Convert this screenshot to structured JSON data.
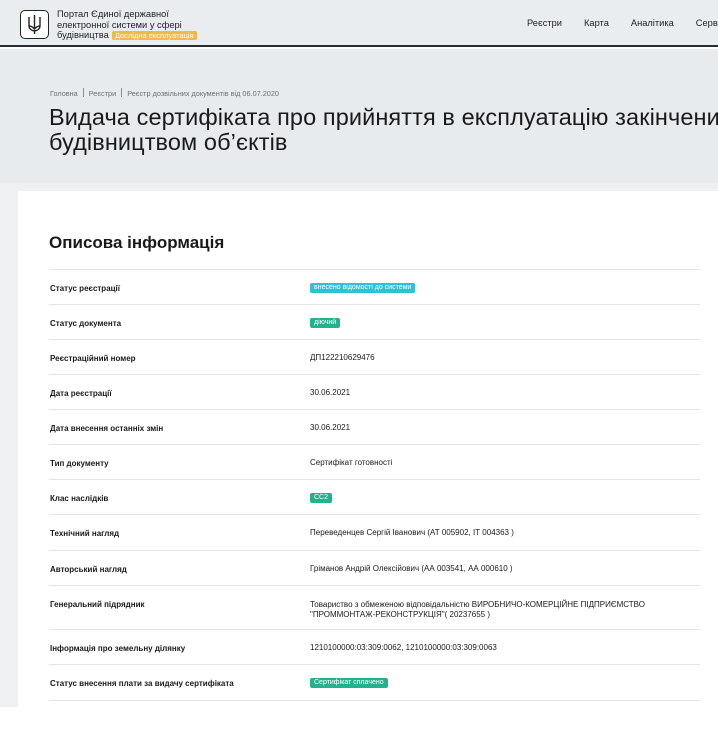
{
  "header": {
    "brand_line1": "Портал Єдиної державної",
    "brand_line2": "електронної системи у сфері",
    "brand_line3": "будівництва",
    "beta_badge": "Дослідна експлуатація",
    "nav": [
      "Реєстри",
      "Карта",
      "Аналітика",
      "Сервіс"
    ]
  },
  "breadcrumb": [
    "Головна",
    "Реєстри",
    "Реєстр дозвільних документів від 06.07.2020"
  ],
  "page_title": "Видача сертифіката про прийняття в експлуатацію закінчених будівництвом об’єктів",
  "section_title": "Описова інформація",
  "rows": [
    {
      "label": "Статус реєстрації",
      "value": "внесено відомості до системи",
      "badge": "blue"
    },
    {
      "label": "Статус документа",
      "value": "діючий",
      "badge": "green"
    },
    {
      "label": "Реєстраційний номер",
      "value": "ДП122210629476"
    },
    {
      "label": "Дата реєстрації",
      "value": "30.06.2021"
    },
    {
      "label": "Дата внесення останніх змін",
      "value": "30.06.2021"
    },
    {
      "label": "Тип документу",
      "value": "Сертифікат готовності"
    },
    {
      "label": "Клас наслідків",
      "value": "СС2",
      "badge": "green"
    },
    {
      "label": "Технічний нагляд",
      "value": "Переведенцев Сергій Іванович (АТ 005902, ІТ 004363 )"
    },
    {
      "label": "Авторський нагляд",
      "value": "Гріманов Андрій Олексійович (АА 003541, АА 000610 )"
    },
    {
      "label": "Генеральний підрядник",
      "value": "Товариство з обмеженою відповідальністю ВИРОБНИЧО-КОМЕРЦІЙНЕ ПІДПРИЄМСТВО",
      "value2": "\"ПРОММОНТАЖ-РЕКОНСТРУКЦІЯ\"( 20237655 )"
    },
    {
      "label": "Інформація про земельну ділянку",
      "value": "1210100000:03:309:0062, 1210100000:03:309:0063"
    },
    {
      "label": "Статус внесення плати за видачу сертифіката",
      "value": "Сертифікат сплачено",
      "badge": "green"
    }
  ]
}
